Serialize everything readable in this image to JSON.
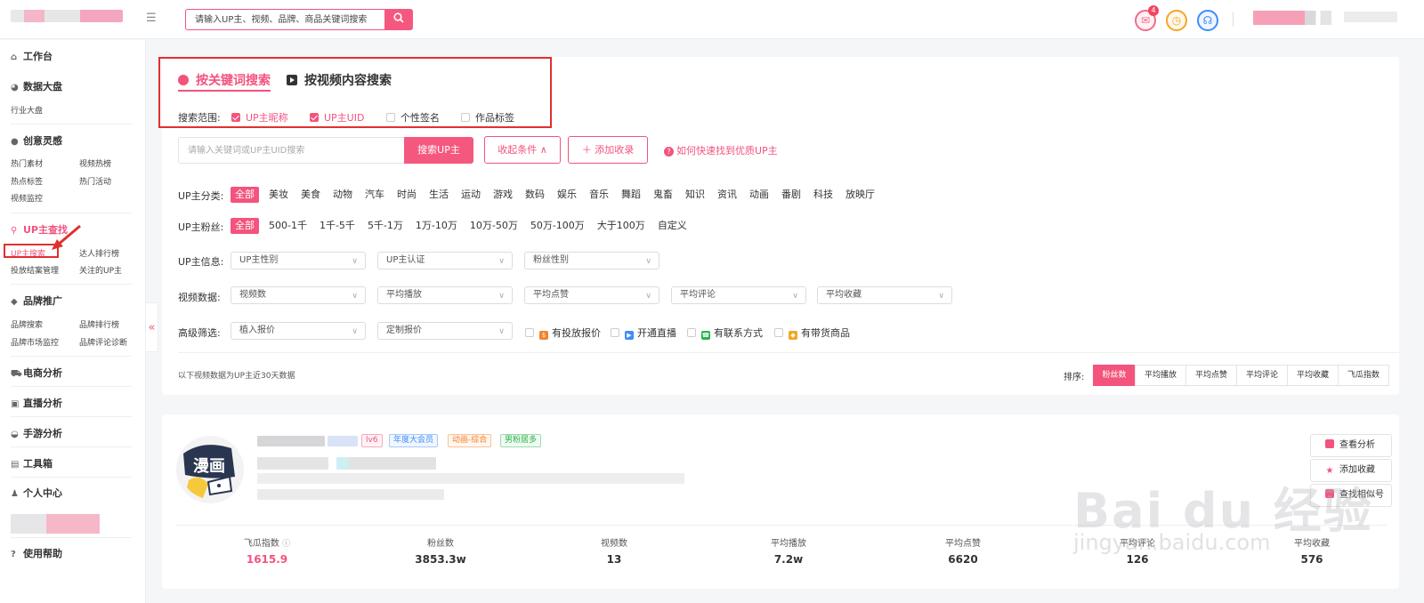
{
  "header": {
    "menu_icon": "menu-fold-icon",
    "search_placeholder": "请输入UP主、视频、品牌、商品关键词搜索",
    "message_badge": "4",
    "icons": [
      "mail-icon",
      "clock-icon",
      "customer-service-icon",
      "search-icon"
    ]
  },
  "sidebar": {
    "workbench": "工作台",
    "data_board": "数据大盘",
    "data_board_items": [
      "行业大盘"
    ],
    "inspiration": "创意灵感",
    "inspiration_items": [
      "热门素材",
      "视频热榜",
      "热点标签",
      "热门活动",
      "视频监控"
    ],
    "up_search": "UP主查找",
    "up_search_items": [
      "UP主搜索",
      "达人排行榜",
      "投放结案管理",
      "关注的UP主"
    ],
    "brand": "品牌推广",
    "brand_items": [
      "品牌搜索",
      "品牌排行榜",
      "品牌市场监控",
      "品牌评论诊断"
    ],
    "ecommerce": "电商分析",
    "live": "直播分析",
    "game": "手游分析",
    "toolbox": "工具箱",
    "personal": "个人中心",
    "help": "使用帮助",
    "collapse_glyph": "«"
  },
  "search": {
    "tab_keyword": "按关键词搜索",
    "tab_video": "按视频内容搜索",
    "range_label": "搜索范围:",
    "range_options": [
      {
        "label": "UP主昵称",
        "checked": true
      },
      {
        "label": "UP主UID",
        "checked": true
      },
      {
        "label": "个性签名",
        "checked": false
      },
      {
        "label": "作品标签",
        "checked": false
      }
    ],
    "input_placeholder": "请输入关键词或UP主UID搜索",
    "search_button": "搜索UP主",
    "collapse_button": "收起条件 ∧",
    "add_button": "＋ 添加收录",
    "help_link": "如何快速找到优质UP主",
    "help_glyph": "?"
  },
  "filters": {
    "category_label": "UP主分类:",
    "categories": [
      "全部",
      "美妆",
      "美食",
      "动物",
      "汽车",
      "时尚",
      "生活",
      "运动",
      "游戏",
      "数码",
      "娱乐",
      "音乐",
      "舞蹈",
      "鬼畜",
      "知识",
      "资讯",
      "动画",
      "番剧",
      "科技",
      "放映厅"
    ],
    "fans_label": "UP主粉丝:",
    "fans": [
      "全部",
      "500-1千",
      "1千-5千",
      "5千-1万",
      "1万-10万",
      "10万-50万",
      "50万-100万",
      "大于100万",
      "自定义"
    ],
    "info_label": "UP主信息:",
    "info_selects": [
      "UP主性别",
      "UP主认证",
      "粉丝性别"
    ],
    "video_label": "视频数据:",
    "video_selects": [
      "视频数",
      "平均播放",
      "平均点赞",
      "平均评论",
      "平均收藏"
    ],
    "adv_label": "高级筛选:",
    "adv_selects": [
      "植入报价",
      "定制报价"
    ],
    "adv_checks": [
      {
        "label": "有投放报价",
        "color": "#f5822a",
        "glyph": "$"
      },
      {
        "label": "开通直播",
        "color": "#3d8ef5",
        "glyph": "▶"
      },
      {
        "label": "有联系方式",
        "color": "#2bb24c",
        "glyph": "☎"
      },
      {
        "label": "有带货商品",
        "color": "#f5a623",
        "glyph": "◆"
      }
    ]
  },
  "results": {
    "note": "以下视频数据为UP主近30天数据",
    "sort_label": "排序:",
    "sort_options": [
      "粉丝数",
      "平均播放",
      "平均点赞",
      "平均评论",
      "平均收藏",
      "飞瓜指数"
    ]
  },
  "card": {
    "avatar_text": "漫画",
    "tags": [
      {
        "label": "lv6",
        "color": "#f3537d"
      },
      {
        "label": "年度大会员",
        "color": "#3d8ef5"
      },
      {
        "label": "动画-综合",
        "color": "#f5822a"
      },
      {
        "label": "男粉居多",
        "color": "#2bb24c"
      }
    ],
    "actions": [
      "查看分析",
      "添加收藏",
      "查找相似号"
    ],
    "stats": [
      {
        "label": "飞瓜指数",
        "value": "1615.9"
      },
      {
        "label": "粉丝数",
        "value": "3853.3w"
      },
      {
        "label": "视频数",
        "value": "13"
      },
      {
        "label": "平均播放",
        "value": "7.2w"
      },
      {
        "label": "平均点赞",
        "value": "6620"
      },
      {
        "label": "平均评论",
        "value": "126"
      },
      {
        "label": "平均收藏",
        "value": "576"
      }
    ]
  },
  "watermark": {
    "line1": "Bai du 经验",
    "line2": "jingyan.baidu.com"
  },
  "colors": {
    "accent": "#f3537d",
    "annotation": "#e0302d"
  }
}
